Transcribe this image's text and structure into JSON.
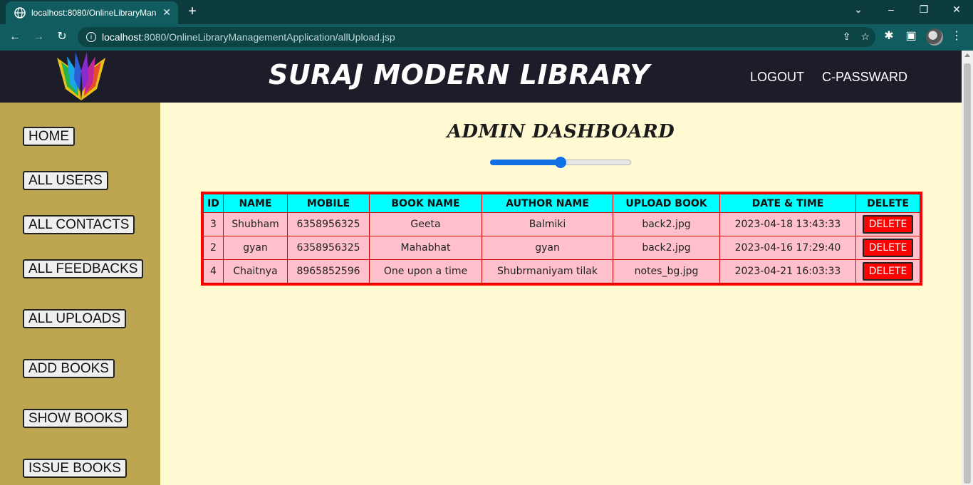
{
  "browser": {
    "tab_title": "localhost:8080/OnlineLibraryMan",
    "url_host": "localhost",
    "url_rest": ":8080/OnlineLibraryManagementApplication/allUpload.jsp"
  },
  "header": {
    "title": "SURAJ MODERN LIBRARY",
    "logout": "LOGOUT",
    "change_password": "C-PASSWARD"
  },
  "sidebar": {
    "items": [
      {
        "label": "HOME"
      },
      {
        "label": "ALL USERS"
      },
      {
        "label": "ALL CONTACTS"
      },
      {
        "label": "ALL FEEDBACKS"
      },
      {
        "label": "ALL UPLOADS"
      },
      {
        "label": "ADD BOOKS"
      },
      {
        "label": "SHOW BOOKS"
      },
      {
        "label": "ISSUE BOOKS"
      }
    ]
  },
  "main": {
    "title": "ADMIN DASHBOARD",
    "slider_value": 0.5,
    "table": {
      "headers": [
        "ID",
        "NAME",
        "MOBILE",
        "BOOK NAME",
        "AUTHOR NAME",
        "UPLOAD BOOK",
        "DATE & TIME",
        "DELETE"
      ],
      "rows": [
        {
          "id": "3",
          "name": "Shubham",
          "mobile": "6358956325",
          "book": "Geeta",
          "author": "Balmiki",
          "file": "back2.jpg",
          "datetime": "2023-04-18 13:43:33",
          "action": "DELETE"
        },
        {
          "id": "2",
          "name": "gyan",
          "mobile": "6358956325",
          "book": "Mahabhat",
          "author": "gyan",
          "file": "back2.jpg",
          "datetime": "2023-04-16 17:29:40",
          "action": "DELETE"
        },
        {
          "id": "4",
          "name": "Chaitnya",
          "mobile": "8965852596",
          "book": "One upon a time",
          "author": "Shubrmaniyam tilak",
          "file": "notes_bg.jpg",
          "datetime": "2023-04-21 16:03:33",
          "action": "DELETE"
        }
      ]
    }
  },
  "colors": {
    "header_bg": "#1d1c29",
    "sidebar_bg": "#bea54f",
    "main_bg": "#fffad1",
    "table_header_bg": "#00ffff",
    "table_row_bg": "#ffc0cb",
    "accent_red": "#ff0000"
  }
}
